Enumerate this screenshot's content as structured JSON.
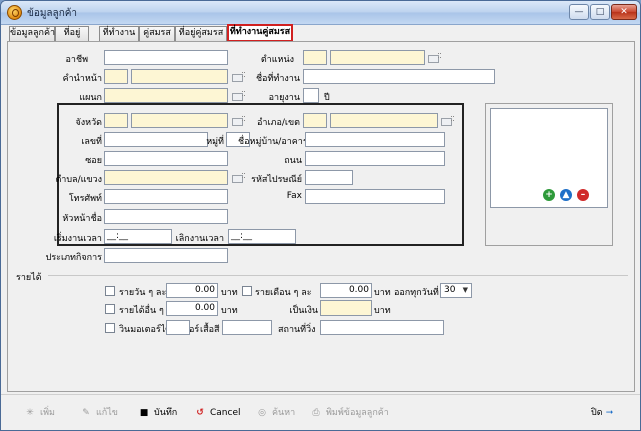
{
  "window": {
    "title": "ข้อมูลลูกค้า"
  },
  "tabs": [
    {
      "label": "ข้อมูลลูกค้า"
    },
    {
      "label": "ที่อยู่"
    },
    {
      "label": "ที่ทำงาน"
    },
    {
      "label": "คู่สมรส"
    },
    {
      "label": "ที่อยู่คู่สมรส"
    },
    {
      "label": "ที่ทำงานคู่สมรส"
    }
  ],
  "form": {
    "occupation_label": "อาชีพ",
    "position_label": "ตำแหน่ง",
    "title_label": "คำนำหน้า",
    "workplace_label": "ชื่อที่ทำงาน",
    "department_label": "แผนก",
    "work_years_label": "อายุงาน",
    "years_unit": "ปี",
    "province_label": "จังหวัด",
    "district_label": "อำเภอ/เขต",
    "house_no_label": "เลขที่",
    "moo_label": "หมู่ที่",
    "building_label": "ชื่อหมู่บ้าน/อาคาร",
    "soi_label": "ซอย",
    "road_label": "ถนน",
    "subdistrict_label": "ตำบล/แขวง",
    "postcode_label": "รหัสไปรษณีย์",
    "phone_label": "โทรศัพท์",
    "fax_label": "Fax",
    "supervisor_label": "หัวหน้าชื่อ",
    "start_time_label": "เริ่มงานเวลา",
    "start_time_value": "__:__",
    "end_time_label": "เลิกงานเวลา",
    "end_time_value": "__:__",
    "business_type_label": "ประเภทกิจการ"
  },
  "income": {
    "section_label": "รายได้",
    "daily_label": "รายวัน ๆ ละ",
    "daily_value": "0.00",
    "baht": "บาท",
    "monthly_label": "รายเดือน ๆ ละ",
    "monthly_value": "0.00",
    "payday_label": "ออกทุกวันที่",
    "payday_value": "30",
    "piece_label": "รายได้อื่น ๆ",
    "piece_value": "0.00",
    "cash_label": "เป็นเงิน",
    "motorbike_label": "วินมอเตอร์ไซค์ เบอร์",
    "vest_color_label": "เสื้อสี",
    "station_label": "สถานที่วิ่ง"
  },
  "toolbar": {
    "add": "เพิ่ม",
    "edit": "แก้ไข",
    "save": "บันทึก",
    "cancel": "Cancel",
    "search": "ค้นหา",
    "print": "พิมพ์ข้อมูลลูกค้า",
    "close": "ปิด"
  },
  "colors": {
    "required_field": "#fdf6d4",
    "active_tab_border": "#d02020"
  }
}
